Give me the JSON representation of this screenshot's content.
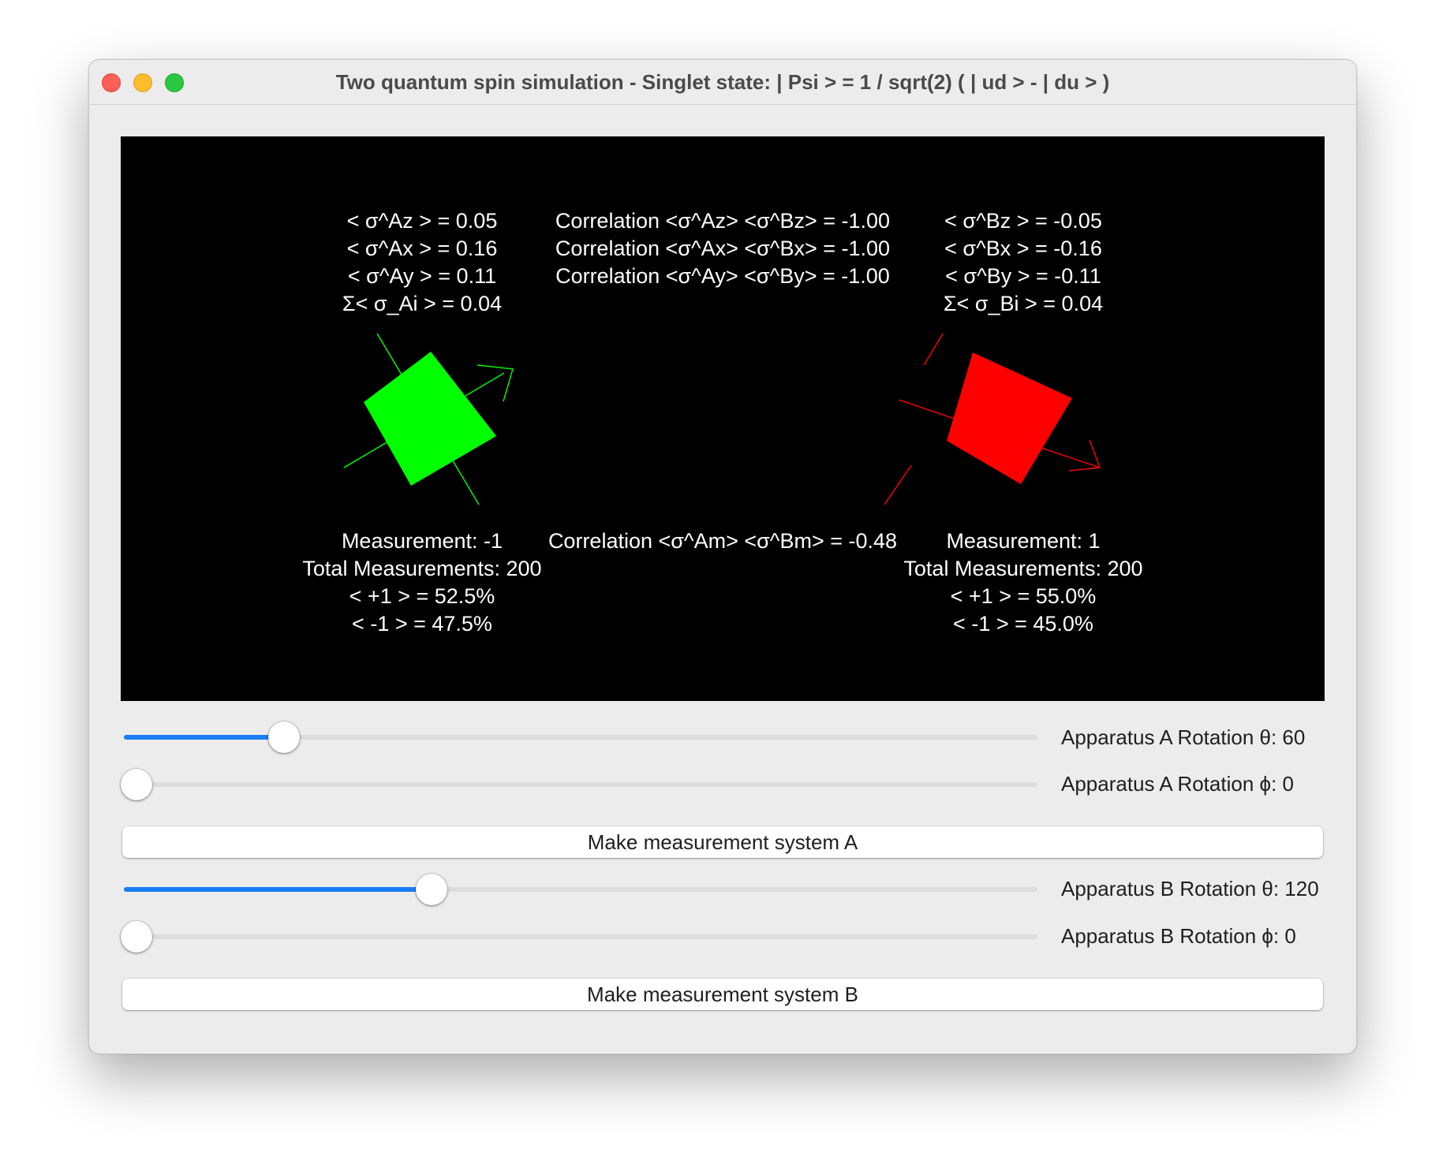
{
  "window": {
    "title": "Two quantum spin simulation - Singlet state: | Psi > = 1 / sqrt(2) ( | ud > - | du > )"
  },
  "canvas": {
    "systemA": {
      "expectations": [
        "< σ^Az > = 0.05",
        "< σ^Ax > = 0.16",
        "< σ^Ay > = 0.11",
        "Σ< σ_Ai > = 0.04"
      ],
      "measurement": [
        "Measurement: -1",
        "Total Measurements: 200",
        "< +1 > = 52.5%",
        "< -1 > = 47.5%"
      ],
      "color": "#00ff00"
    },
    "systemB": {
      "expectations": [
        "< σ^Bz > = -0.05",
        "< σ^Bx > = -0.16",
        "< σ^By > = -0.11",
        "Σ< σ_Bi > = 0.04"
      ],
      "measurement": [
        "Measurement: 1",
        "Total Measurements: 200",
        "< +1 > = 55.0%",
        "< -1 > = 45.0%"
      ],
      "color": "#ff0000"
    },
    "correlations": [
      "Correlation <σ^Az> <σ^Bz> = -1.00",
      "Correlation <σ^Ax> <σ^Bx> = -1.00",
      "Correlation <σ^Ay> <σ^By> = -1.00"
    ],
    "measured_correlation": "Correlation <σ^Am> <σ^Bm> = -0.48"
  },
  "controls": {
    "sliderA_theta": {
      "label": "Apparatus A Rotation θ: 60",
      "value": 60,
      "max": 360
    },
    "sliderA_phi": {
      "label": "Apparatus A Rotation ϕ: 0",
      "value": 0,
      "max": 360
    },
    "buttonA": "Make measurement system A",
    "sliderB_theta": {
      "label": "Apparatus B Rotation θ: 120",
      "value": 120,
      "max": 360
    },
    "sliderB_phi": {
      "label": "Apparatus B Rotation ϕ: 0",
      "value": 0,
      "max": 360
    },
    "buttonB": "Make measurement system B"
  },
  "colors": {
    "accent": "#1a7ef5",
    "background": "#ececec"
  }
}
